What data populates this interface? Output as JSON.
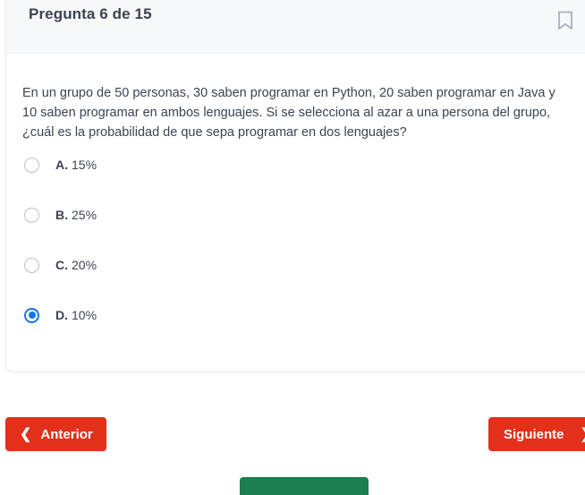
{
  "question": {
    "title": "Pregunta 6 de 15",
    "text": "En un grupo de 50 personas, 30 saben programar en Python, 20 saben programar en Java y 10 saben programar en ambos lenguajes. Si se selecciona al azar a una persona del grupo, ¿cuál es la probabilidad de que sepa programar en dos lenguajes?"
  },
  "options": [
    {
      "letter": "A.",
      "text": "15%",
      "selected": false
    },
    {
      "letter": "B.",
      "text": "25%",
      "selected": false
    },
    {
      "letter": "C.",
      "text": "20%",
      "selected": false
    },
    {
      "letter": "D.",
      "text": "10%",
      "selected": true
    }
  ],
  "navigation": {
    "prev_label": "Anterior",
    "prev_icon": "chevron-left-icon",
    "next_label": "Siguiente",
    "next_icon": "chevron-right-icon"
  },
  "colors": {
    "accent": "#e2301a",
    "radio_selected": "#1a73e8",
    "bottom_button": "#1b7f52"
  }
}
